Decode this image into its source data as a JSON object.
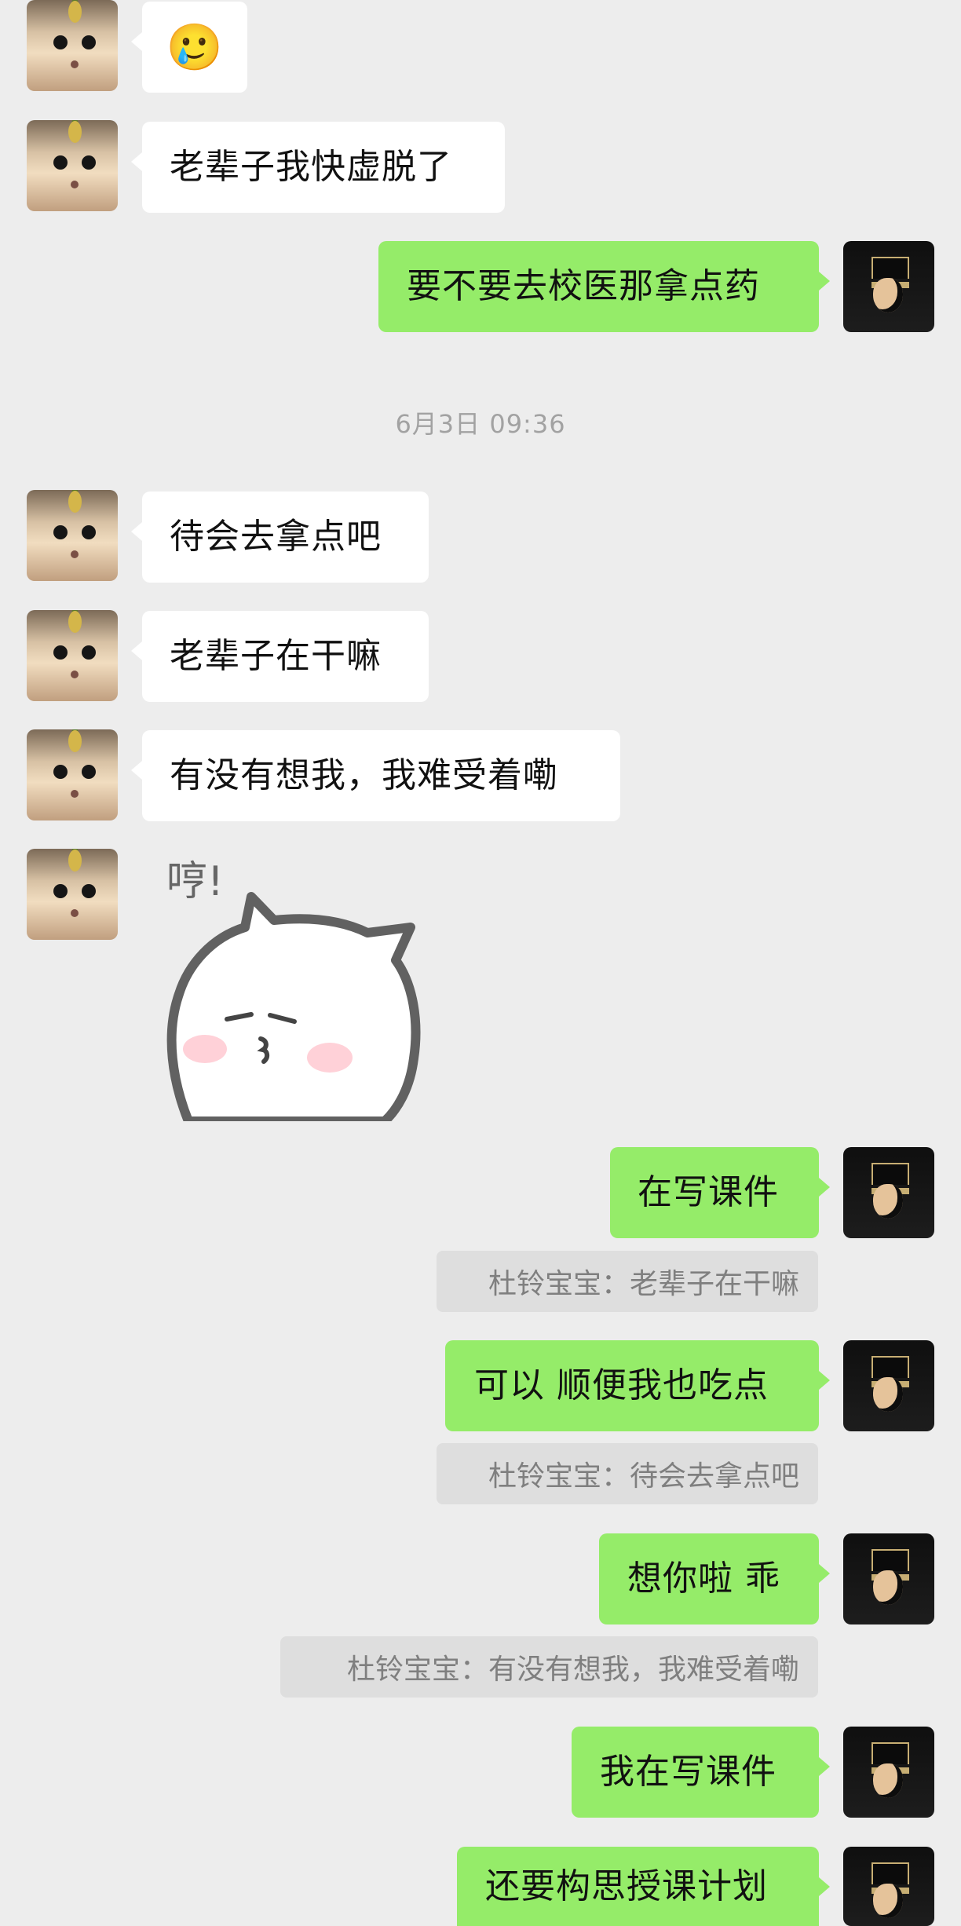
{
  "conversation": {
    "timestamp": "6月3日 09:36",
    "messages": [
      {
        "text": "🥲"
      },
      {
        "text": "老辈子我快虚脱了"
      },
      {
        "text": "要不要去校医那拿点药"
      },
      {
        "text": "待会去拿点吧"
      },
      {
        "text": "老辈子在干嘛"
      },
      {
        "text": "有没有想我，我难受着嘞"
      },
      {
        "text": "在写课件"
      },
      {
        "text": "可以 顺便我也吃点"
      },
      {
        "text": "想你啦 乖"
      },
      {
        "text": "我在写课件"
      },
      {
        "text": "还要构思授课计划"
      }
    ],
    "quotes": [
      "杜铃宝宝：老辈子在干嘛",
      "杜铃宝宝：待会去拿点吧",
      "杜铃宝宝：有没有想我，我难受着嘞"
    ],
    "sticker": {
      "text": "哼!"
    }
  }
}
